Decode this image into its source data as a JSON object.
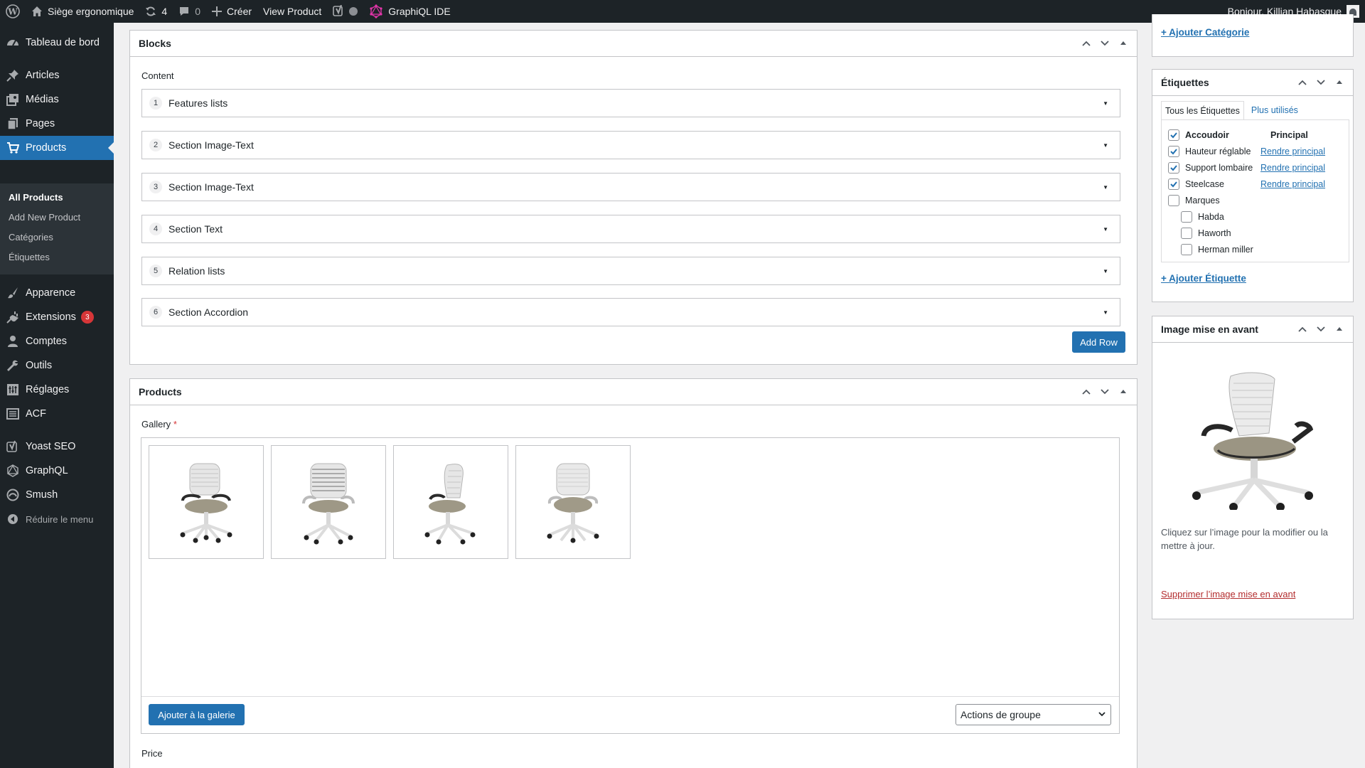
{
  "adminbar": {
    "site_name": "Siège ergonomique",
    "updates_count": "4",
    "comments_count": "0",
    "new_label": "Créer",
    "view_product": "View Product",
    "graphql_ide": "GraphiQL IDE",
    "greeting": "Bonjour, Killian Habasque"
  },
  "sidebar": {
    "dashboard": "Tableau de bord",
    "posts": "Articles",
    "media": "Médias",
    "pages": "Pages",
    "products": "Products",
    "products_sub": [
      "All Products",
      "Add New Product",
      "Catégories",
      "Étiquettes"
    ],
    "appearance": "Apparence",
    "plugins": "Extensions",
    "plugins_badge": "3",
    "users": "Comptes",
    "tools": "Outils",
    "settings": "Réglages",
    "acf": "ACF",
    "yoast": "Yoast SEO",
    "graphql": "GraphQL",
    "smush": "Smush",
    "collapse": "Réduire le menu"
  },
  "top_link": "+ Ajouter Catégorie",
  "blocks": {
    "title": "Blocks",
    "content_label": "Content",
    "rows": [
      {
        "num": "1",
        "label": "Features lists"
      },
      {
        "num": "2",
        "label": "Section Image-Text"
      },
      {
        "num": "3",
        "label": "Section Image-Text"
      },
      {
        "num": "4",
        "label": "Section Text"
      },
      {
        "num": "5",
        "label": "Relation lists"
      },
      {
        "num": "6",
        "label": "Section Accordion"
      }
    ],
    "add_row": "Add Row"
  },
  "products_box": {
    "title": "Products",
    "gallery_label": "Gallery",
    "required_mark": "*",
    "gallery_images": [
      "chair-front-left",
      "chair-back",
      "chair-side",
      "chair-front"
    ],
    "add_to_gallery": "Ajouter à la galerie",
    "bulk_actions": "Actions de groupe",
    "price_label": "Price"
  },
  "tags_box": {
    "title": "Étiquettes",
    "tab_all": "Tous les Étiquettes",
    "tab_popular": "Plus utilisés",
    "tags": [
      {
        "name": "Accoudoir",
        "checked": true,
        "action": "Principal",
        "indent": false
      },
      {
        "name": "Hauteur réglable",
        "checked": true,
        "action": "Rendre principal",
        "indent": false
      },
      {
        "name": "Support lombaire",
        "checked": true,
        "action": "Rendre principal",
        "indent": false
      },
      {
        "name": "Steelcase",
        "checked": true,
        "action": "Rendre principal",
        "indent": false
      },
      {
        "name": "Marques",
        "checked": false,
        "action": "",
        "indent": false
      },
      {
        "name": "Habda",
        "checked": false,
        "action": "",
        "indent": true
      },
      {
        "name": "Haworth",
        "checked": false,
        "action": "",
        "indent": true
      },
      {
        "name": "Herman miller",
        "checked": false,
        "action": "",
        "indent": true
      }
    ],
    "add_tag": "+ Ajouter Étiquette"
  },
  "featured_box": {
    "title": "Image mise en avant",
    "caption": "Cliquez sur l’image pour la modifier ou la mettre à jour.",
    "remove_link": "Supprimer l’image mise en avant"
  },
  "colors": {
    "admin_dark": "#1d2327",
    "accent": "#2271b1",
    "badge": "#d63638",
    "danger_link": "#b32d2e"
  }
}
